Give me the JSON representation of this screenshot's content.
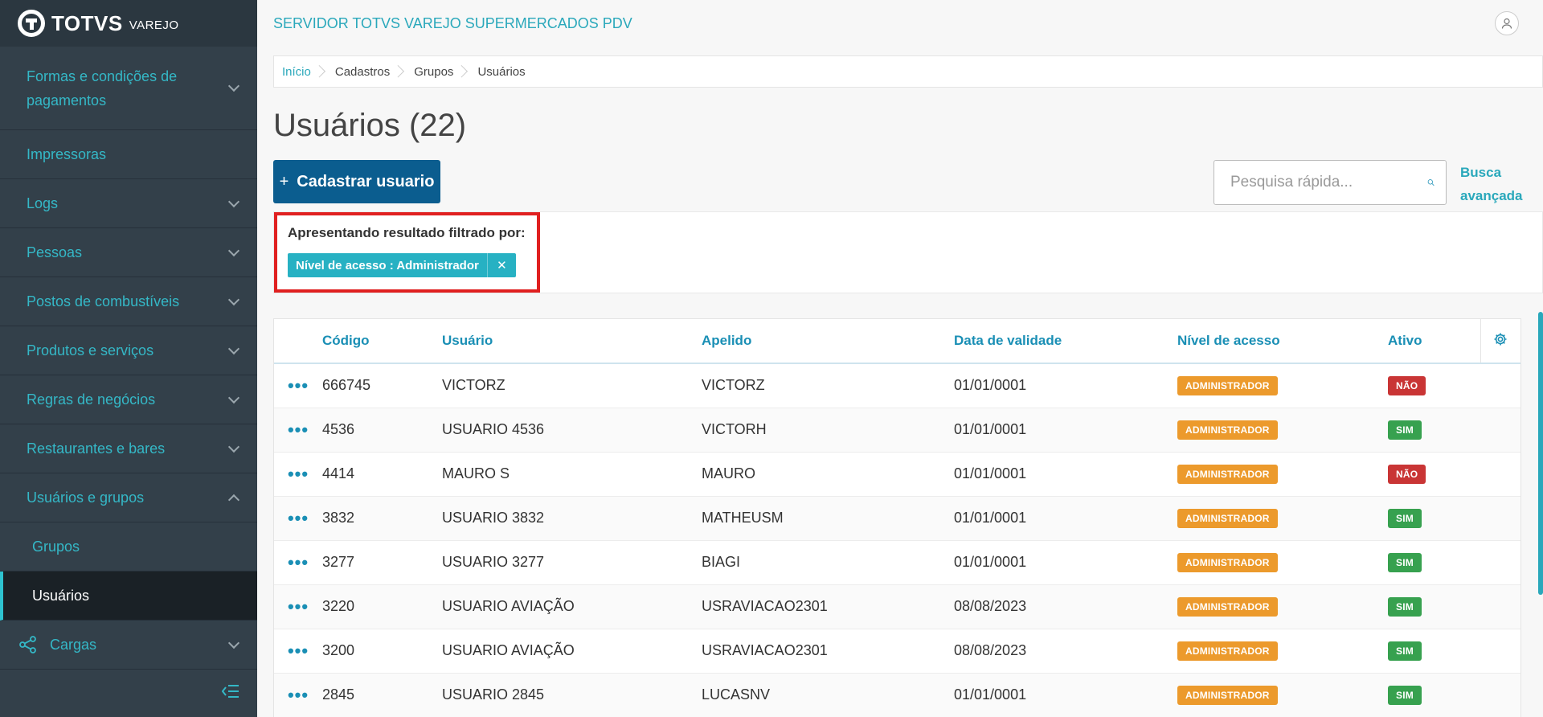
{
  "logo": {
    "name": "TOTVS",
    "sub": "VAREJO"
  },
  "sidebar": {
    "items": [
      {
        "label": "Formas e condições de pagamentos",
        "expand": "down"
      },
      {
        "label": "Impressoras"
      },
      {
        "label": "Logs",
        "expand": "down"
      },
      {
        "label": "Pessoas",
        "expand": "down"
      },
      {
        "label": "Postos de combustíveis",
        "expand": "down"
      },
      {
        "label": "Produtos e serviços",
        "expand": "down"
      },
      {
        "label": "Regras de negócios",
        "expand": "down"
      },
      {
        "label": "Restaurantes e bares",
        "expand": "down"
      },
      {
        "label": "Usuários e grupos",
        "expand": "up"
      },
      {
        "label": "Grupos"
      },
      {
        "label": "Usuários"
      },
      {
        "label": "Cargas",
        "expand": "down"
      }
    ]
  },
  "header": {
    "title": "SERVIDOR TOTVS VAREJO SUPERMERCADOS PDV"
  },
  "breadcrumb": [
    "Início",
    "Cadastros",
    "Grupos",
    "Usuários"
  ],
  "page": {
    "title": "Usuários (22)",
    "add_label": "Cadastrar usuario",
    "search_placeholder": "Pesquisa rápida...",
    "adv_search_line1": "Busca",
    "adv_search_line2": "avançada"
  },
  "filter": {
    "label": "Apresentando resultado filtrado por:",
    "chip": "Nível de acesso : Administrador",
    "chip_close": "✕"
  },
  "table": {
    "columns": [
      "Código",
      "Usuário",
      "Apelido",
      "Data de validade",
      "Nível de acesso",
      "Ativo"
    ],
    "rows": [
      {
        "codigo": "666745",
        "usuario": "VICTORZ",
        "apelido": "VICTORZ",
        "validade": "01/01/0001",
        "nivel": "ADMINISTRADOR",
        "ativo": "NÃO"
      },
      {
        "codigo": "4536",
        "usuario": "USUARIO 4536",
        "apelido": "VICTORH",
        "validade": "01/01/0001",
        "nivel": "ADMINISTRADOR",
        "ativo": "SIM"
      },
      {
        "codigo": "4414",
        "usuario": "MAURO S",
        "apelido": "MAURO",
        "validade": "01/01/0001",
        "nivel": "ADMINISTRADOR",
        "ativo": "NÃO"
      },
      {
        "codigo": "3832",
        "usuario": "USUARIO 3832",
        "apelido": "MATHEUSM",
        "validade": "01/01/0001",
        "nivel": "ADMINISTRADOR",
        "ativo": "SIM"
      },
      {
        "codigo": "3277",
        "usuario": "USUARIO 3277",
        "apelido": "BIAGI",
        "validade": "01/01/0001",
        "nivel": "ADMINISTRADOR",
        "ativo": "SIM"
      },
      {
        "codigo": "3220",
        "usuario": "USUARIO AVIAÇÃO",
        "apelido": "USRAVIACAO2301",
        "validade": "08/08/2023",
        "nivel": "ADMINISTRADOR",
        "ativo": "SIM"
      },
      {
        "codigo": "3200",
        "usuario": "USUARIO AVIAÇÃO",
        "apelido": "USRAVIACAO2301",
        "validade": "08/08/2023",
        "nivel": "ADMINISTRADOR",
        "ativo": "SIM"
      },
      {
        "codigo": "2845",
        "usuario": "USUARIO 2845",
        "apelido": "LUCASNV",
        "validade": "01/01/0001",
        "nivel": "ADMINISTRADOR",
        "ativo": "SIM"
      }
    ]
  },
  "colors": {
    "accent": "#2aa8bb",
    "primary_button": "#0b5d8f",
    "sidebar": "#33404a",
    "badge_admin": "#ec9a2c",
    "badge_sim": "#37a14f",
    "badge_nao": "#c93535",
    "highlight": "#e02020"
  }
}
